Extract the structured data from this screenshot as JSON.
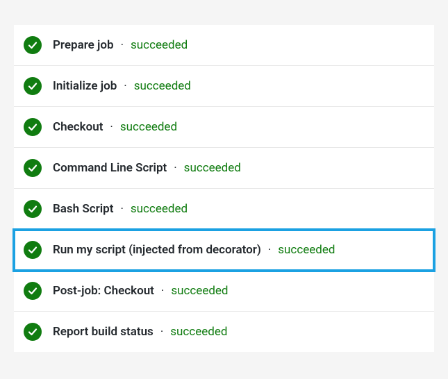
{
  "steps": [
    {
      "label": "Prepare job",
      "status": "succeeded",
      "highlighted": false
    },
    {
      "label": "Initialize job",
      "status": "succeeded",
      "highlighted": false
    },
    {
      "label": "Checkout",
      "status": "succeeded",
      "highlighted": false
    },
    {
      "label": "Command Line Script",
      "status": "succeeded",
      "highlighted": false
    },
    {
      "label": "Bash Script",
      "status": "succeeded",
      "highlighted": false
    },
    {
      "label": "Run my script (injected from decorator)",
      "status": "succeeded",
      "highlighted": true
    },
    {
      "label": "Post-job: Checkout",
      "status": "succeeded",
      "highlighted": false
    },
    {
      "label": "Report build status",
      "status": "succeeded",
      "highlighted": false
    }
  ],
  "separator": "·",
  "colors": {
    "success": "#107c10",
    "highlight": "#1ba1e2"
  }
}
